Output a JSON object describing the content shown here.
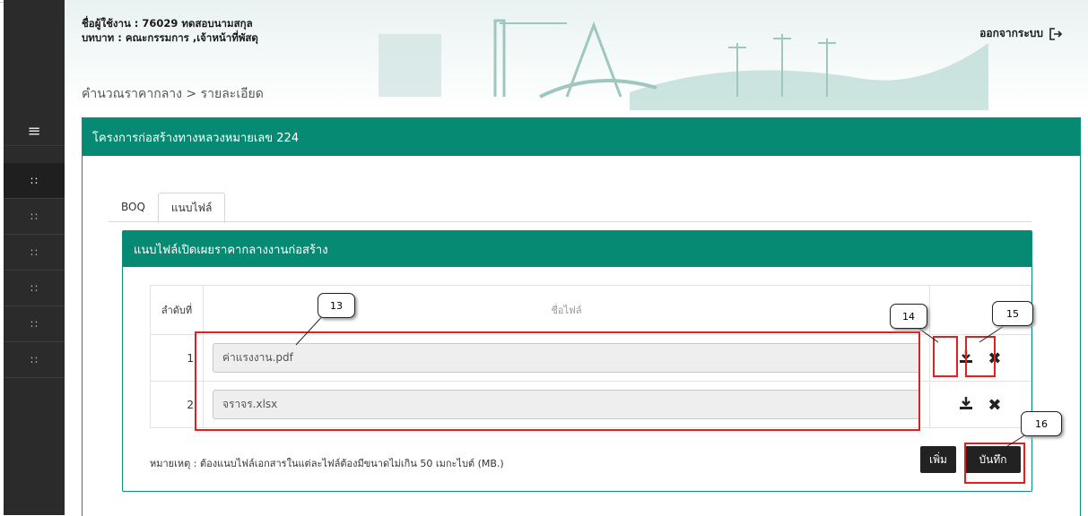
{
  "header": {
    "user_line": "ชื่อผู้ใช้งาน : 76029 ทดสอบนามสกุล",
    "role_line": "บทบาท : คณะกรรมการ ,เจ้าหน้าที่พัสดุ",
    "breadcrumb": "คำนวณราคากลาง > รายละเอียด",
    "logout_label": "ออกจากระบบ"
  },
  "sidebar": {
    "toggle_icon": "menu-icon",
    "items": [
      {
        "icon": "grid-icon",
        "active": true
      },
      {
        "icon": "grid-icon"
      },
      {
        "icon": "grid-icon"
      },
      {
        "icon": "grid-icon"
      },
      {
        "icon": "grid-icon"
      },
      {
        "icon": "grid-icon"
      }
    ]
  },
  "card": {
    "title": "โครงการก่อสร้างทางหลวงหมายเลข 224"
  },
  "tabs": [
    {
      "label": "BOQ"
    },
    {
      "label": "แนบไฟล์",
      "active": true
    }
  ],
  "panel": {
    "title": "แนบไฟล์เปิดเผยราคากลางงานก่อสร้าง",
    "table": {
      "col_no": "ลำดับที่",
      "col_file": "ชื่อไฟล์",
      "rows": [
        {
          "no": "1",
          "file": "ค่าแรงงาน.pdf"
        },
        {
          "no": "2",
          "file": "จราจร.xlsx"
        }
      ]
    },
    "note": "หมายเหตุ : ต้องแนบไฟล์เอกสารในแต่ละไฟล์ต้องมีขนาดไม่เกิน 50 เมกะไบต์ (MB.)",
    "add_label": "เพิ่ม",
    "save_label": "บันทึก"
  },
  "callouts": {
    "c13": "13",
    "c14": "14",
    "c15": "15",
    "c16": "16"
  },
  "colors": {
    "accent": "#078a73",
    "sidebar": "#2b2b2b",
    "callout_box": "#e02020"
  }
}
